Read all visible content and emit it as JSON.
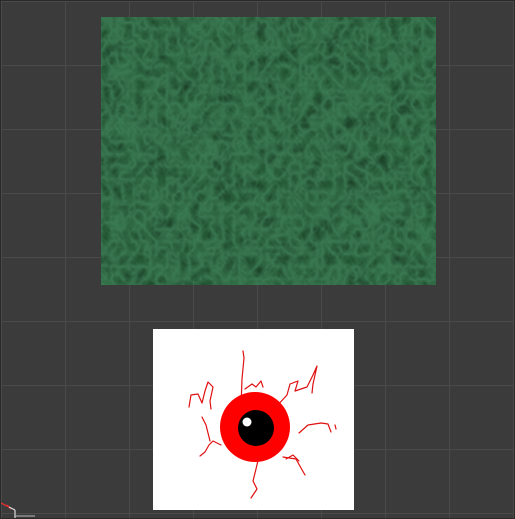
{
  "viewport": {
    "name": "image-canvas-view",
    "background_color": "#3b3b3b",
    "grid_color": "#4a4a4a"
  },
  "images": [
    {
      "name": "green-noise-texture",
      "description_colors": {
        "dark": "#0f3a1c",
        "mid": "#2a6a3e",
        "light": "#6fb487"
      }
    },
    {
      "name": "bloodshot-eyeball-sprite",
      "description_colors": {
        "background": "#ffffff",
        "iris": "#ff0000",
        "pupil": "#000000",
        "highlight": "#ffffff",
        "veins": "#e01010"
      }
    }
  ],
  "gizmo": {
    "icon": "origin-axis-icon",
    "x_axis_color": "#e03030",
    "y_axis_color": "#ffffff"
  }
}
